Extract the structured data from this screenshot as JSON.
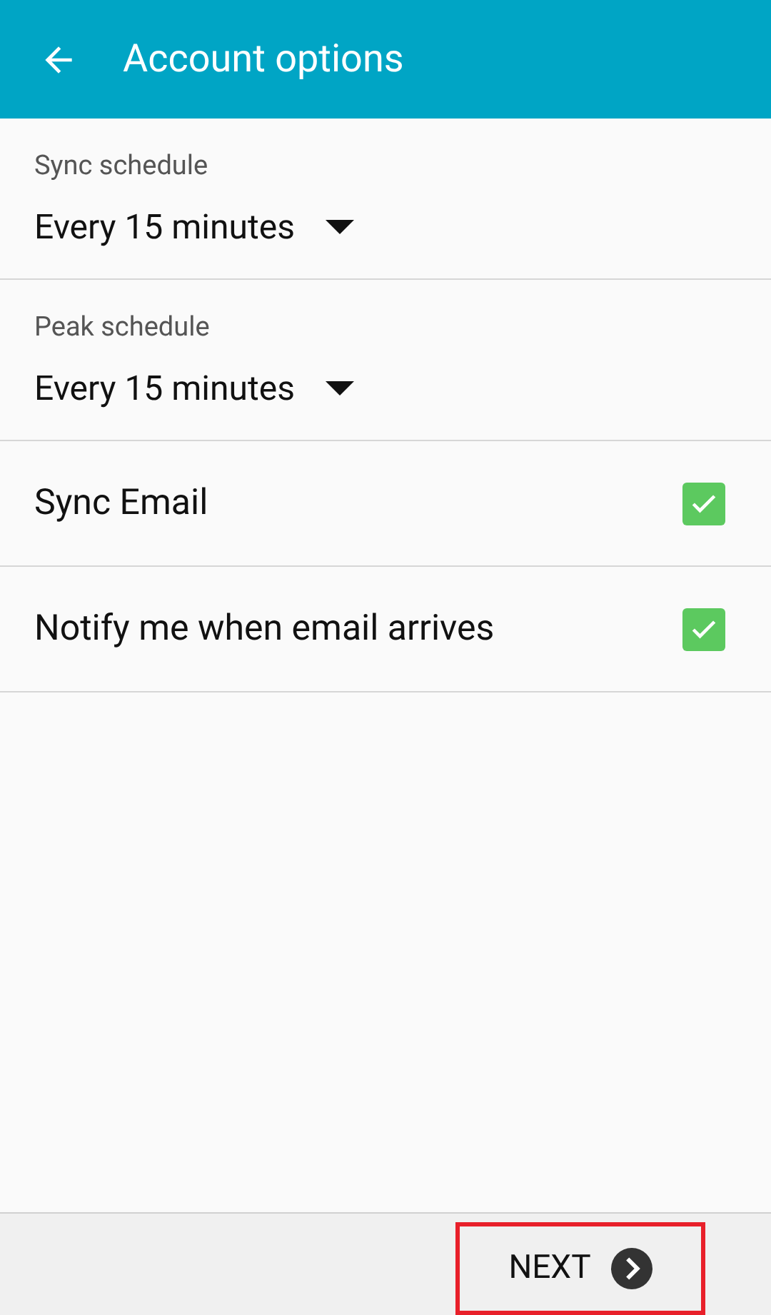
{
  "header": {
    "title": "Account options"
  },
  "schedules": [
    {
      "label": "Sync schedule",
      "value": "Every 15 minutes"
    },
    {
      "label": "Peak schedule",
      "value": "Every 15 minutes"
    }
  ],
  "toggles": [
    {
      "label": "Sync Email",
      "checked": true
    },
    {
      "label": "Notify me when email arrives",
      "checked": true
    }
  ],
  "next_button": {
    "label": "NEXT",
    "highlighted": true
  }
}
